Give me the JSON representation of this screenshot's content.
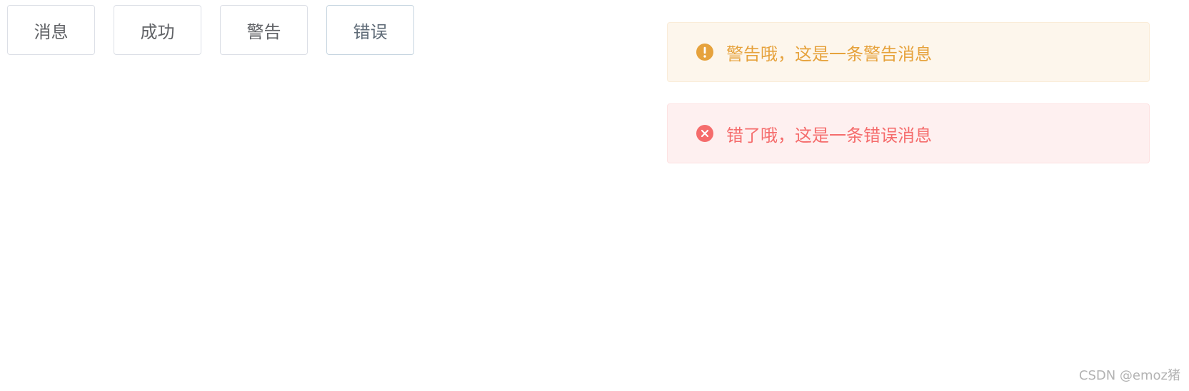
{
  "buttons": [
    {
      "label": "消息"
    },
    {
      "label": "成功"
    },
    {
      "label": "警告"
    },
    {
      "label": "错误"
    }
  ],
  "messages": {
    "warning": {
      "text": "警告哦，这是一条警告消息",
      "icon": "warning-icon",
      "color": "#e6a23c",
      "background": "#fdf6ec"
    },
    "error": {
      "text": "错了哦，这是一条错误消息",
      "icon": "error-icon",
      "color": "#f56c6c",
      "background": "#fef0f0"
    }
  },
  "watermark": "CSDN @emoz猪"
}
